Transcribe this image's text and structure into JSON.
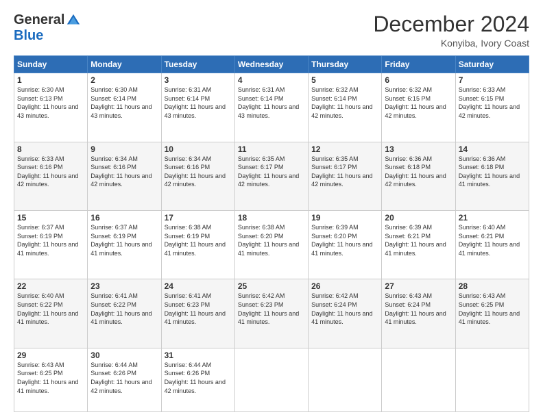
{
  "logo": {
    "general": "General",
    "blue": "Blue"
  },
  "title": "December 2024",
  "location": "Konyiba, Ivory Coast",
  "days_of_week": [
    "Sunday",
    "Monday",
    "Tuesday",
    "Wednesday",
    "Thursday",
    "Friday",
    "Saturday"
  ],
  "weeks": [
    [
      {
        "day": "1",
        "sunrise": "6:30 AM",
        "sunset": "6:13 PM",
        "daylight": "11 hours and 43 minutes."
      },
      {
        "day": "2",
        "sunrise": "6:30 AM",
        "sunset": "6:14 PM",
        "daylight": "11 hours and 43 minutes."
      },
      {
        "day": "3",
        "sunrise": "6:31 AM",
        "sunset": "6:14 PM",
        "daylight": "11 hours and 43 minutes."
      },
      {
        "day": "4",
        "sunrise": "6:31 AM",
        "sunset": "6:14 PM",
        "daylight": "11 hours and 43 minutes."
      },
      {
        "day": "5",
        "sunrise": "6:32 AM",
        "sunset": "6:14 PM",
        "daylight": "11 hours and 42 minutes."
      },
      {
        "day": "6",
        "sunrise": "6:32 AM",
        "sunset": "6:15 PM",
        "daylight": "11 hours and 42 minutes."
      },
      {
        "day": "7",
        "sunrise": "6:33 AM",
        "sunset": "6:15 PM",
        "daylight": "11 hours and 42 minutes."
      }
    ],
    [
      {
        "day": "8",
        "sunrise": "6:33 AM",
        "sunset": "6:16 PM",
        "daylight": "11 hours and 42 minutes."
      },
      {
        "day": "9",
        "sunrise": "6:34 AM",
        "sunset": "6:16 PM",
        "daylight": "11 hours and 42 minutes."
      },
      {
        "day": "10",
        "sunrise": "6:34 AM",
        "sunset": "6:16 PM",
        "daylight": "11 hours and 42 minutes."
      },
      {
        "day": "11",
        "sunrise": "6:35 AM",
        "sunset": "6:17 PM",
        "daylight": "11 hours and 42 minutes."
      },
      {
        "day": "12",
        "sunrise": "6:35 AM",
        "sunset": "6:17 PM",
        "daylight": "11 hours and 42 minutes."
      },
      {
        "day": "13",
        "sunrise": "6:36 AM",
        "sunset": "6:18 PM",
        "daylight": "11 hours and 42 minutes."
      },
      {
        "day": "14",
        "sunrise": "6:36 AM",
        "sunset": "6:18 PM",
        "daylight": "11 hours and 41 minutes."
      }
    ],
    [
      {
        "day": "15",
        "sunrise": "6:37 AM",
        "sunset": "6:19 PM",
        "daylight": "11 hours and 41 minutes."
      },
      {
        "day": "16",
        "sunrise": "6:37 AM",
        "sunset": "6:19 PM",
        "daylight": "11 hours and 41 minutes."
      },
      {
        "day": "17",
        "sunrise": "6:38 AM",
        "sunset": "6:19 PM",
        "daylight": "11 hours and 41 minutes."
      },
      {
        "day": "18",
        "sunrise": "6:38 AM",
        "sunset": "6:20 PM",
        "daylight": "11 hours and 41 minutes."
      },
      {
        "day": "19",
        "sunrise": "6:39 AM",
        "sunset": "6:20 PM",
        "daylight": "11 hours and 41 minutes."
      },
      {
        "day": "20",
        "sunrise": "6:39 AM",
        "sunset": "6:21 PM",
        "daylight": "11 hours and 41 minutes."
      },
      {
        "day": "21",
        "sunrise": "6:40 AM",
        "sunset": "6:21 PM",
        "daylight": "11 hours and 41 minutes."
      }
    ],
    [
      {
        "day": "22",
        "sunrise": "6:40 AM",
        "sunset": "6:22 PM",
        "daylight": "11 hours and 41 minutes."
      },
      {
        "day": "23",
        "sunrise": "6:41 AM",
        "sunset": "6:22 PM",
        "daylight": "11 hours and 41 minutes."
      },
      {
        "day": "24",
        "sunrise": "6:41 AM",
        "sunset": "6:23 PM",
        "daylight": "11 hours and 41 minutes."
      },
      {
        "day": "25",
        "sunrise": "6:42 AM",
        "sunset": "6:23 PM",
        "daylight": "11 hours and 41 minutes."
      },
      {
        "day": "26",
        "sunrise": "6:42 AM",
        "sunset": "6:24 PM",
        "daylight": "11 hours and 41 minutes."
      },
      {
        "day": "27",
        "sunrise": "6:43 AM",
        "sunset": "6:24 PM",
        "daylight": "11 hours and 41 minutes."
      },
      {
        "day": "28",
        "sunrise": "6:43 AM",
        "sunset": "6:25 PM",
        "daylight": "11 hours and 41 minutes."
      }
    ],
    [
      {
        "day": "29",
        "sunrise": "6:43 AM",
        "sunset": "6:25 PM",
        "daylight": "11 hours and 41 minutes."
      },
      {
        "day": "30",
        "sunrise": "6:44 AM",
        "sunset": "6:26 PM",
        "daylight": "11 hours and 42 minutes."
      },
      {
        "day": "31",
        "sunrise": "6:44 AM",
        "sunset": "6:26 PM",
        "daylight": "11 hours and 42 minutes."
      },
      null,
      null,
      null,
      null
    ]
  ]
}
